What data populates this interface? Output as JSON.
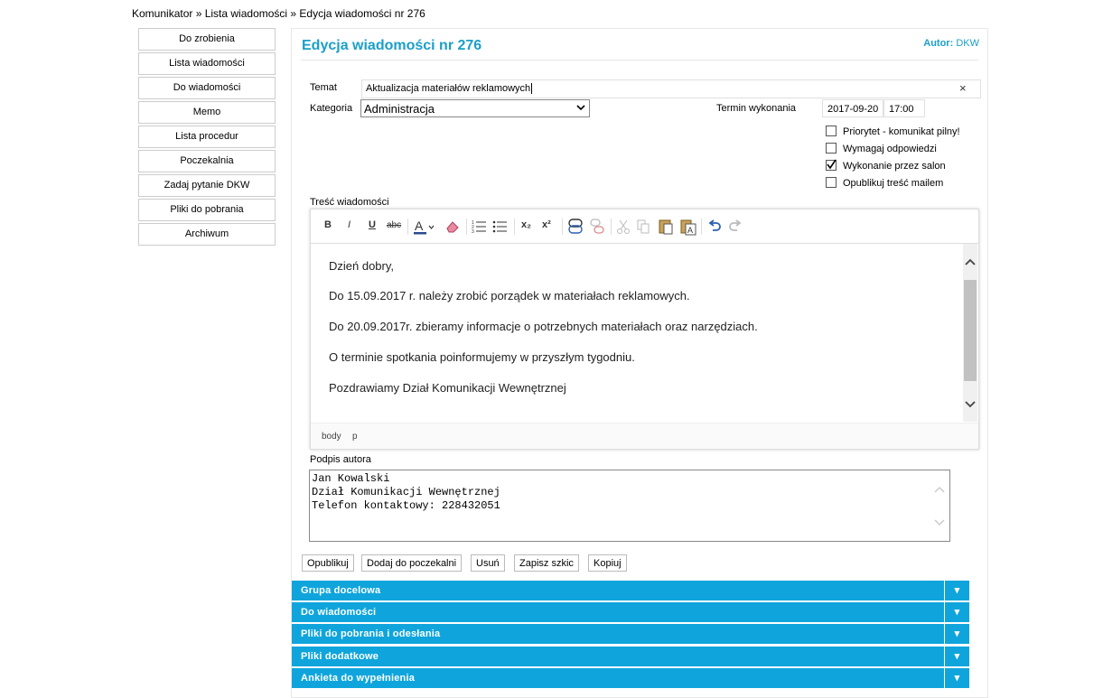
{
  "breadcrumb": "Komunikator » Lista wiadomości » Edycja wiadomości nr 276",
  "sidebar": {
    "items": [
      {
        "label": "Do zrobienia"
      },
      {
        "label": "Lista wiadomości"
      },
      {
        "label": "Do wiadomości"
      },
      {
        "label": "Memo"
      },
      {
        "label": "Lista procedur"
      },
      {
        "label": "Poczekalnia"
      },
      {
        "label": "Zadaj pytanie DKW"
      },
      {
        "label": "Pliki do pobrania"
      },
      {
        "label": "Archiwum"
      }
    ]
  },
  "header": {
    "title": "Edycja wiadomości nr 276",
    "author_label": "Autor:",
    "author_value": "DKW"
  },
  "form": {
    "temat_label": "Temat",
    "temat_value": "Aktualizacja materiałów reklamowych",
    "temat_clear": "×",
    "kategoria_label": "Kategoria",
    "kategoria_value": "Administracja",
    "termin_label": "Termin wykonania",
    "termin_date": "2017-09-20",
    "termin_time": "17:00",
    "checkboxes": [
      {
        "label": "Priorytet - komunikat pilny!",
        "checked": false
      },
      {
        "label": "Wymagaj odpowiedzi",
        "checked": false
      },
      {
        "label": "Wykonanie przez salon",
        "checked": true
      },
      {
        "label": "Opublikuj treść mailem",
        "checked": false
      }
    ],
    "tresc_label": "Treść wiadomości",
    "podpis_label": "Podpis autora"
  },
  "editor": {
    "toolbar": {
      "bold": "B",
      "italic": "I",
      "underline": "U",
      "strike": "abc",
      "subscript": "x₂",
      "superscript": "x²"
    },
    "paragraphs": [
      "Dzień dobry,",
      "Do 15.09.2017 r. należy zrobić porządek w materiałach reklamowych.",
      "Do 20.09.2017r. zbieramy informacje o potrzebnych materiałach oraz narzędziach.",
      "O terminie spotkania poinformujemy w przyszłym tygodniu.",
      "Pozdrawiamy Dział Komunikacji Wewnętrznej"
    ],
    "path": [
      "body",
      "p"
    ]
  },
  "signature": {
    "lines": [
      "Jan Kowalski",
      "Dział Komunikacji Wewnętrznej",
      "Telefon kontaktowy: 228432051"
    ]
  },
  "buttons": {
    "publish": "Opublikuj",
    "add_waiting": "Dodaj do poczekalni",
    "delete": "Usuń",
    "save_draft": "Zapisz szkic",
    "copy": "Kopiuj"
  },
  "accordion": [
    {
      "label": "Grupa docelowa"
    },
    {
      "label": "Do wiadomości"
    },
    {
      "label": "Pliki do pobrania i odesłania"
    },
    {
      "label": "Pliki dodatkowe"
    },
    {
      "label": "Ankieta do wypełnienia"
    }
  ],
  "colors": {
    "accent": "#1a9fc8",
    "accordion_bg": "#0fa5dc"
  }
}
